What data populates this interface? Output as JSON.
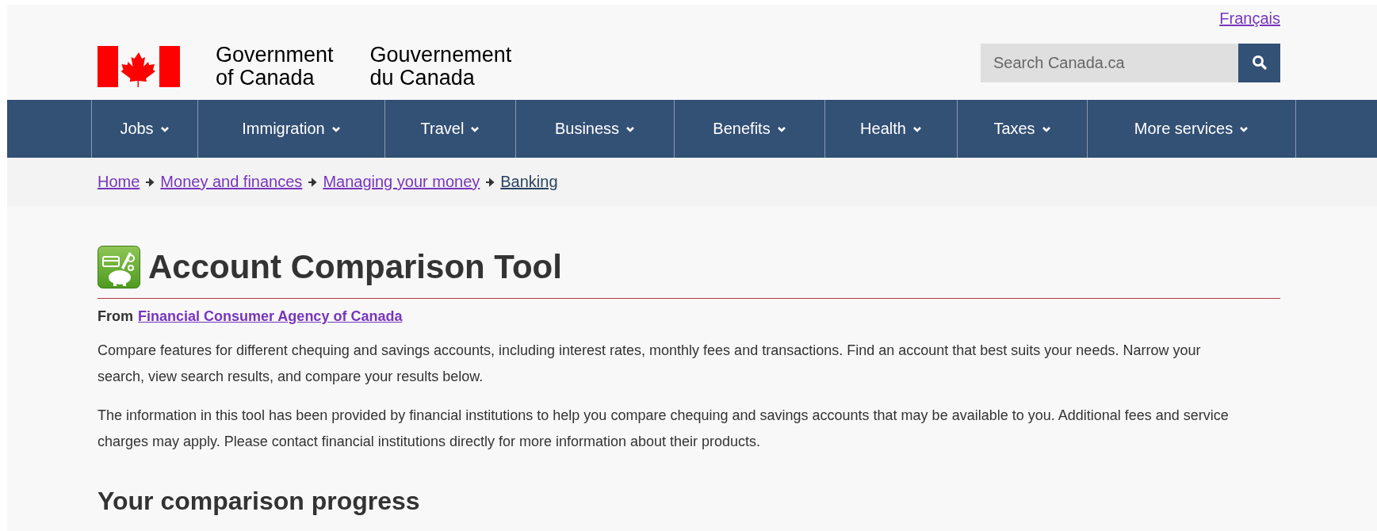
{
  "header": {
    "language_link": "Français",
    "signature": {
      "english": [
        "Government",
        "of Canada"
      ],
      "french": [
        "Gouvernement",
        "du Canada"
      ]
    },
    "search": {
      "placeholder": "Search Canada.ca"
    }
  },
  "nav": {
    "items": [
      {
        "label": "Jobs"
      },
      {
        "label": "Immigration"
      },
      {
        "label": "Travel"
      },
      {
        "label": "Business"
      },
      {
        "label": "Benefits"
      },
      {
        "label": "Health"
      },
      {
        "label": "Taxes"
      },
      {
        "label": "More services"
      }
    ]
  },
  "breadcrumb": [
    {
      "label": "Home",
      "current": false
    },
    {
      "label": "Money and finances",
      "current": false
    },
    {
      "label": "Managing your money",
      "current": false
    },
    {
      "label": "Banking",
      "current": true
    }
  ],
  "page": {
    "title": "Account Comparison Tool",
    "source_label": "From",
    "source_link": "Financial Consumer Agency of Canada",
    "paragraphs": [
      "Compare features for different chequing and savings accounts, including interest rates, monthly fees and transactions. Find an account that best suits your needs. Narrow your search, view search results, and compare your results below.",
      "The information in this tool has been provided by financial institutions to help you compare chequing and savings accounts that may be available to you. Additional fees and service charges may apply. Please contact financial institutions directly for more information about their products."
    ],
    "section_heading": "Your comparison progress"
  }
}
